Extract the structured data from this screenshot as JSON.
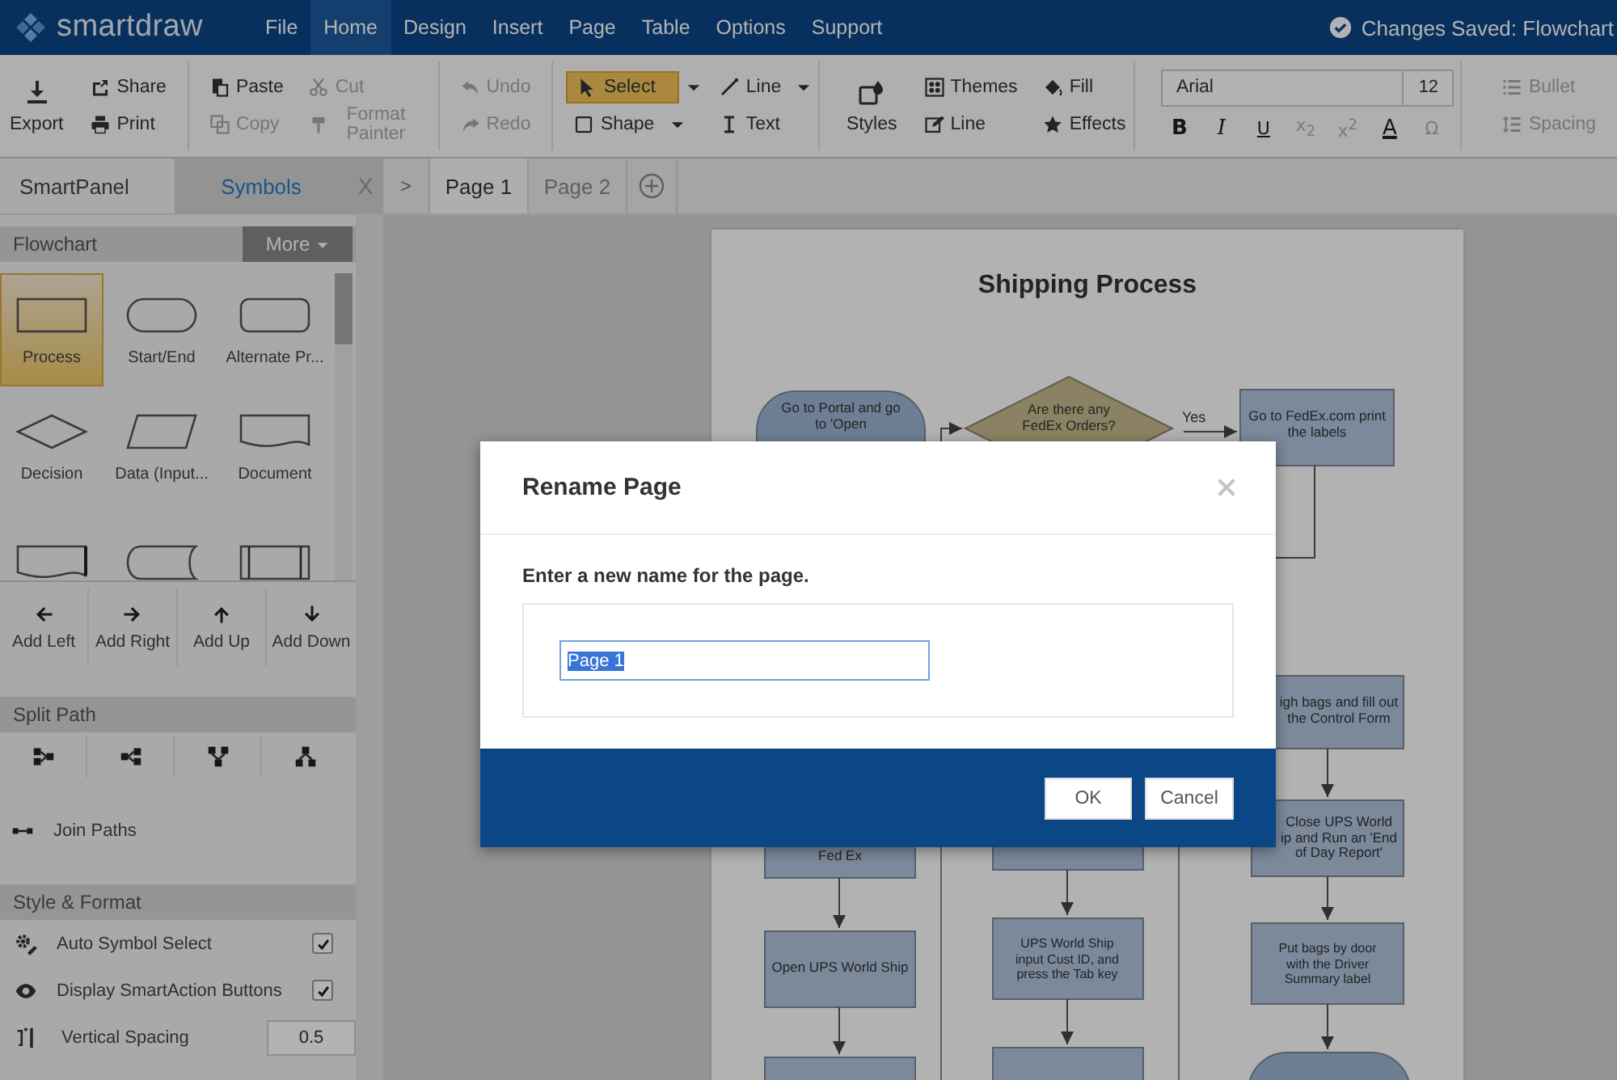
{
  "app": {
    "logo": "smartdraw"
  },
  "menu": [
    {
      "label": "File",
      "selected": false
    },
    {
      "label": "Home",
      "selected": true
    },
    {
      "label": "Design",
      "selected": false
    },
    {
      "label": "Insert",
      "selected": false
    },
    {
      "label": "Page",
      "selected": false
    },
    {
      "label": "Table",
      "selected": false
    },
    {
      "label": "Options",
      "selected": false
    },
    {
      "label": "Support",
      "selected": false
    }
  ],
  "status": {
    "text": "Changes Saved: Flowchart"
  },
  "ribbon": [
    {
      "kind": "stack",
      "big": {
        "label": "Export"
      },
      "items": [
        {
          "label": "Share",
          "disabled": false
        },
        {
          "label": "Print",
          "disabled": false
        }
      ]
    },
    {
      "kind": "grid",
      "items": [
        {
          "label": "Paste",
          "disabled": false
        },
        {
          "label": "Cut",
          "disabled": true
        },
        {
          "label": "Copy",
          "disabled": true
        },
        {
          "label": "Format Painter",
          "disabled": true
        }
      ]
    },
    {
      "kind": "stack",
      "items": [
        {
          "label": "Undo",
          "disabled": true
        },
        {
          "label": "Redo",
          "disabled": true
        }
      ]
    },
    {
      "kind": "grid",
      "items": [
        {
          "label": "Select",
          "disabled": false,
          "selected": true,
          "caret": true
        },
        {
          "label": "Line",
          "disabled": false,
          "selected": false,
          "caret": true
        },
        {
          "label": "Shape",
          "disabled": false,
          "selected": false,
          "caret": true
        },
        {
          "label": "Text",
          "disabled": false,
          "selected": false,
          "caret": false
        }
      ]
    },
    {
      "kind": "grid",
      "big": {
        "label": "Styles"
      },
      "items": [
        {
          "label": "Themes",
          "disabled": false
        },
        {
          "label": "Fill",
          "disabled": false
        },
        {
          "label": "Line",
          "disabled": false
        },
        {
          "label": "Effects",
          "disabled": false
        }
      ]
    },
    {
      "kind": "font",
      "font": "Arial",
      "size": "12",
      "buttons": [
        {
          "kind": "bold",
          "label": "B",
          "disabled": false
        },
        {
          "kind": "italic",
          "label": "I",
          "disabled": false
        },
        {
          "kind": "underline",
          "label": "U",
          "disabled": false
        },
        {
          "kind": "plain",
          "label": "x$_{2}$",
          "disabled": true
        },
        {
          "kind": "plain",
          "label": "x$^{2}$",
          "disabled": true
        },
        {
          "kind": "color",
          "label": "A",
          "disabled": false
        },
        {
          "kind": "plain",
          "label": "Ω",
          "disabled": true
        }
      ]
    },
    {
      "kind": "stack",
      "items": [
        {
          "label": "Bullet",
          "disabled": true
        },
        {
          "label": "Spacing",
          "disabled": true
        }
      ]
    }
  ],
  "panel_tabs": [
    {
      "label": "SmartPanel",
      "selected": false
    },
    {
      "label": "Symbols",
      "selected": true
    }
  ],
  "panel_close": "X",
  "page_nav": ">",
  "page_tabs": [
    {
      "label": "Page 1",
      "selected": true
    },
    {
      "label": "Page 2",
      "selected": false
    }
  ],
  "library": {
    "title": "Flowchart",
    "more": "More",
    "shapes": [
      {
        "label": "Process",
        "selected": true
      },
      {
        "label": "Start/End",
        "selected": false
      },
      {
        "label": "Alternate Pr...",
        "selected": false
      },
      {
        "label": "Decision",
        "selected": false
      },
      {
        "label": "Data (Input...",
        "selected": false
      },
      {
        "label": "Document",
        "selected": false
      },
      {
        "selected": false
      },
      {
        "selected": false
      },
      {
        "selected": false
      }
    ]
  },
  "add_buttons": [
    "Add Left",
    "Add Right",
    "Add Up",
    "Add Down"
  ],
  "split_path": {
    "title": "Split Path"
  },
  "join": {
    "label": "Join Paths"
  },
  "style_format": {
    "title": "Style & Format",
    "options": [
      {
        "kind": "checkbox",
        "label": "Auto Symbol Select",
        "checked": true
      },
      {
        "kind": "checkbox",
        "label": "Display SmartAction Buttons",
        "checked": true
      },
      {
        "kind": "number",
        "label": "Vertical Spacing",
        "value": "0.5"
      }
    ]
  },
  "diagram": {
    "title": "Shipping Process",
    "yes_label": "Yes",
    "nodes": [
      {
        "kind": "terminator",
        "text": "Go to Portal and go to 'Open"
      },
      {
        "kind": "decision",
        "text": "Are there any FedEx Orders?"
      },
      {
        "kind": "process",
        "text": "Go to FedEx.com print the labels"
      },
      {
        "kind": "process",
        "text": "igh bags and fill out the Control Form"
      },
      {
        "kind": "process",
        "text": "Close UPS World\nip and Run an 'End\nof Day Report'"
      },
      {
        "kind": "process",
        "text": "Put bags by door with the Driver Summary label"
      },
      {
        "kind": "terminator"
      },
      {
        "kind": "process",
        "text": "Fed Ex"
      },
      {
        "kind": "process",
        "text": "Open UPS World Ship"
      },
      {
        "kind": "process"
      },
      {
        "kind": "process"
      },
      {
        "kind": "process",
        "text": "UPS World Ship input Cust ID, and press the Tab key"
      },
      {
        "kind": "process"
      }
    ]
  },
  "dialog": {
    "title": "Rename Page",
    "prompt": "Enter a new name for the page.",
    "value": "Page 1",
    "value_selected": true,
    "buttons": [
      "OK",
      "Cancel"
    ]
  }
}
